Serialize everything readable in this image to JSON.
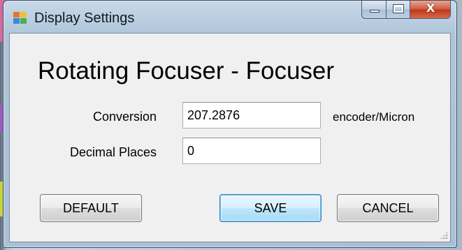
{
  "window": {
    "title": "Display Settings",
    "close_glyph": "X"
  },
  "form": {
    "heading": "Rotating Focuser - Focuser",
    "conversion_label": "Conversion",
    "conversion_value": "207.2876",
    "conversion_unit": "encoder/Micron",
    "decimals_label": "Decimal Places",
    "decimals_value": "0"
  },
  "buttons": {
    "default_label": "DEFAULT",
    "save_label": "SAVE",
    "cancel_label": "CANCEL"
  },
  "icons": {
    "app": "app-icon",
    "minimize": "minimize-icon",
    "maximize": "maximize-icon",
    "close": "close-icon",
    "grip": "resize-grip-icon"
  },
  "colors": {
    "title_bar": "#b9cde0",
    "client_bg": "#f0f0f0",
    "close_button": "#c1361d",
    "focused_button_border": "#3c7fb1"
  }
}
